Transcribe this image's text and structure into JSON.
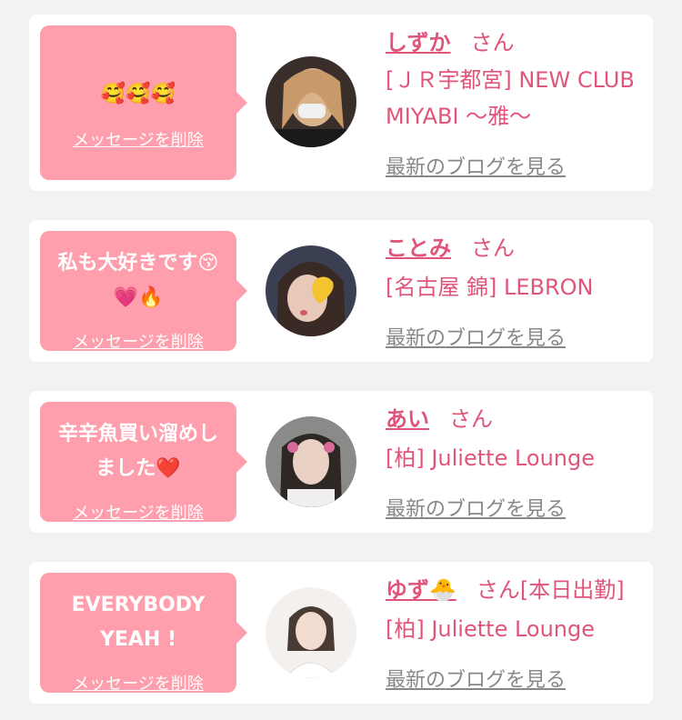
{
  "colors": {
    "page_bg": "#f2f2f2",
    "card_bg": "#ffffff",
    "bubble_pink": "#ff9fad",
    "name_pink": "#e0557a",
    "link_gray": "#888888"
  },
  "delete_label": "メッセージを削除",
  "honorific": "さん",
  "blog_label": "最新のブログを見る",
  "items": [
    {
      "message": "🥰🥰🥰",
      "name": "しずか",
      "name_suffix": "",
      "status": "",
      "shop": "[ＪＲ宇都宮] NEW CLUB MIYABI 〜雅〜"
    },
    {
      "message_line1": "私も大好きです😚",
      "message_line2": "💗🔥",
      "name": "ことみ",
      "name_suffix": "",
      "status": "",
      "shop": "[名古屋 錦] LEBRON"
    },
    {
      "message_line1": "辛辛魚買い溜めし",
      "message_line2": "ました❤️",
      "name": "あい",
      "name_suffix": "",
      "status": "",
      "shop": "[柏] Juliette Lounge"
    },
    {
      "message_line1": "EVERYBODY",
      "message_line2": "YEAH !",
      "name": "ゆず",
      "name_suffix": "🐣",
      "status": "[本日出勤]",
      "shop": "[柏] Juliette Lounge"
    }
  ]
}
